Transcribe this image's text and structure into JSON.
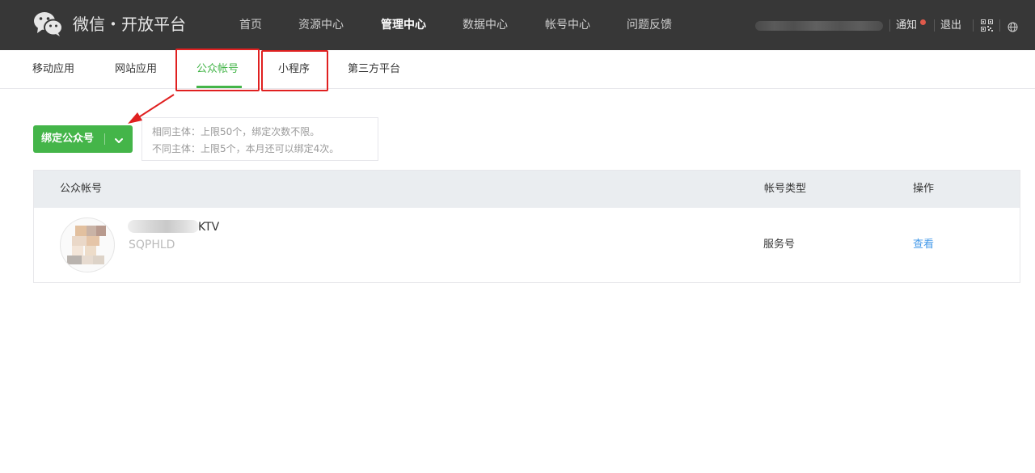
{
  "header": {
    "logo_icon": "wechat-logo-icon",
    "logo_text": "微信・开放平台",
    "nav": [
      {
        "label": "首页"
      },
      {
        "label": "资源中心"
      },
      {
        "label": "管理中心",
        "active": true
      },
      {
        "label": "数据中心"
      },
      {
        "label": "帐号中心"
      },
      {
        "label": "问题反馈"
      }
    ],
    "notice_label": "通知",
    "logout_label": "退出",
    "icons": [
      "qrcode-icon",
      "globe-icon"
    ]
  },
  "subtabs": [
    {
      "label": "移动应用"
    },
    {
      "label": "网站应用"
    },
    {
      "label": "公众帐号",
      "active": true
    },
    {
      "label": "小程序"
    },
    {
      "label": "第三方平台"
    }
  ],
  "bind": {
    "button_label": "绑定公众号",
    "tip_line1": "相同主体：上限50个，绑定次数不限。",
    "tip_line2": "不同主体：上限5个，本月还可以绑定4次。"
  },
  "table": {
    "headers": [
      "公众帐号",
      "帐号类型",
      "操作"
    ],
    "rows": [
      {
        "name_suffix": "KTV",
        "account_id": "SQPHLD",
        "type": "服务号",
        "action": "查看"
      }
    ]
  },
  "colors": {
    "header_bg": "#373737",
    "accent_green": "#44b549",
    "highlight_red": "#e02020",
    "link_blue": "#459ae9"
  }
}
